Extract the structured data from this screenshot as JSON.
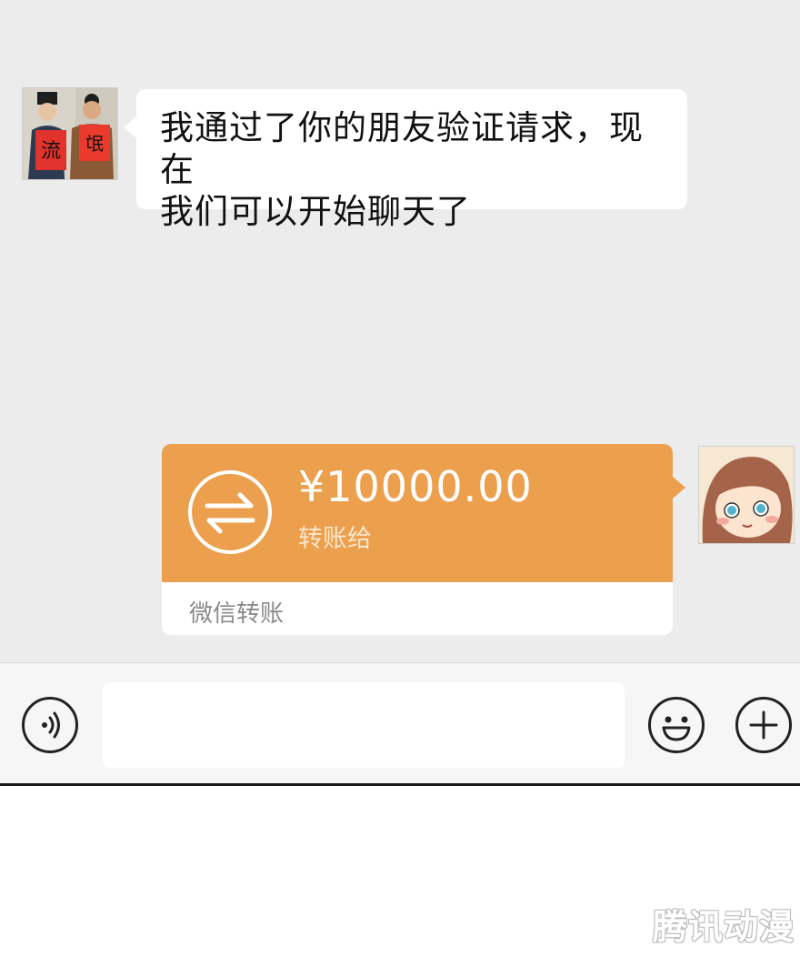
{
  "messages": [
    {
      "sender": "contact",
      "text_line1": "我通过了你的朋友验证请求，现在",
      "text_line2": "我们可以开始聊天了"
    }
  ],
  "transfer": {
    "amount": "¥10000.00",
    "subtitle": "转账给",
    "footer": "微信转账",
    "icon": "transfer-arrows-icon",
    "color": "#eca04e"
  },
  "contact_avatar": {
    "sign_left": "流",
    "sign_right": "氓"
  },
  "input_bar": {
    "voice_icon": "voice-icon",
    "emoji_icon": "emoji-icon",
    "plus_icon": "plus-icon",
    "placeholder": ""
  },
  "watermark": "腾讯动漫"
}
